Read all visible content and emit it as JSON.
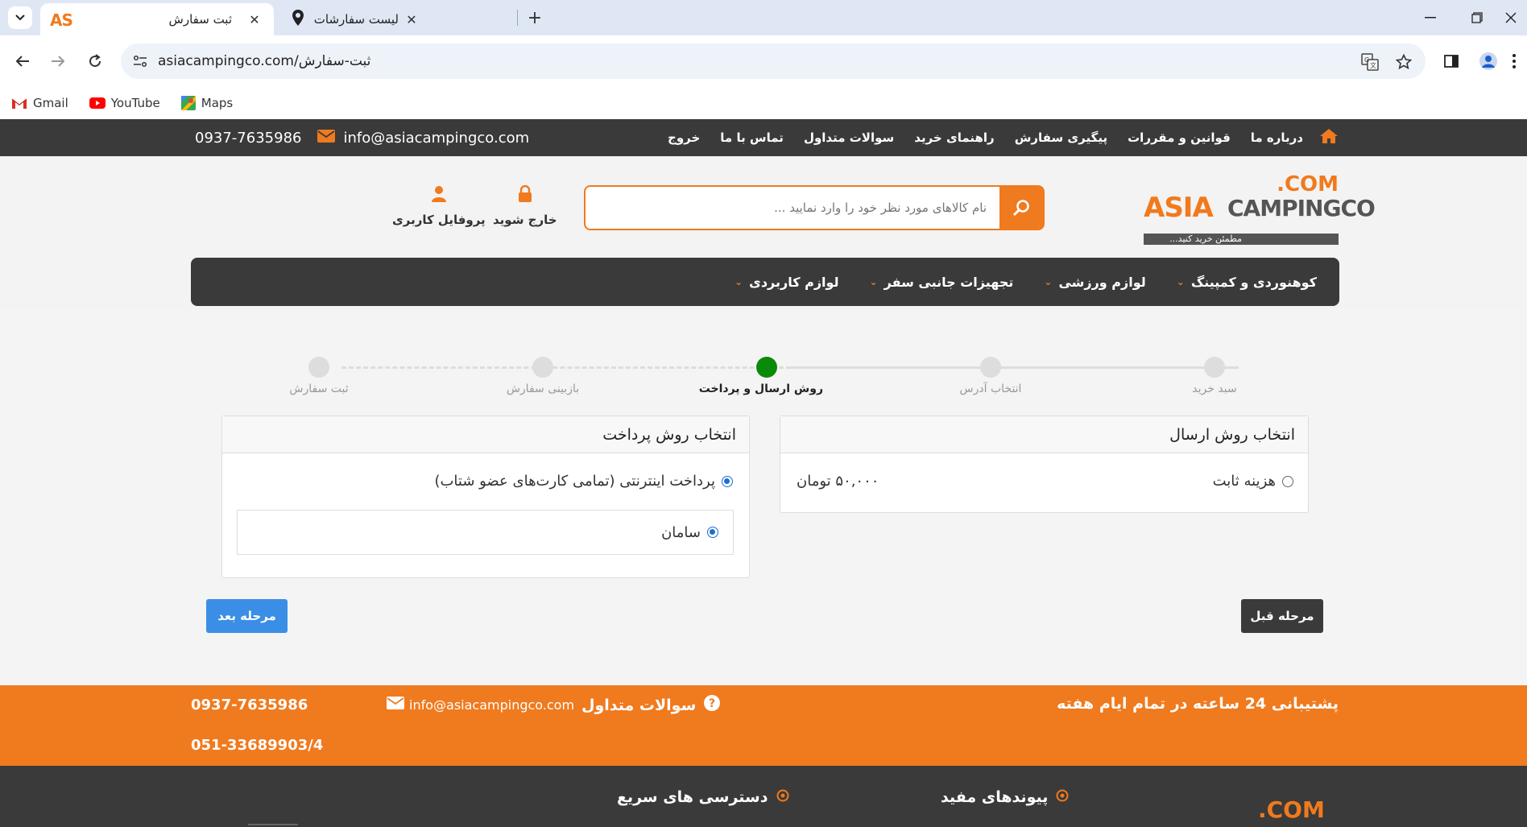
{
  "browser": {
    "tabs": [
      {
        "title": "ثبت سفارش",
        "favicon": "AS",
        "active": true
      },
      {
        "title": "لیست سفارشات",
        "active": false
      }
    ],
    "url": "asiacampingco.com/ثبت-سفارش",
    "bookmarks": [
      {
        "label": "Gmail"
      },
      {
        "label": "YouTube"
      },
      {
        "label": "Maps"
      }
    ]
  },
  "topbar": {
    "phone": "0937-7635986",
    "email": "info@asiacampingco.com",
    "menu": [
      "درباره ما",
      "قوانین و مقررات",
      "پیگیری سفارش",
      "راهنمای خرید",
      "سوالات متداول",
      "تماس با ما",
      "خروج"
    ]
  },
  "header": {
    "logo": {
      "dotcom": ".COM",
      "asia": "ASIA",
      "camping": "CAMPINGCO",
      "tagline": "مطمئن خرید کنید..."
    },
    "search_placeholder": "نام کالاهای مورد نظر خود را وارد نمایید ...",
    "logout_label": "خارج شوید",
    "profile_label": "پروفایل کاربری"
  },
  "categories": [
    "کوهنوردی و کمپینگ",
    "لوازم ورزشی",
    "تجهیزات جانبی سفر",
    "لوازم کاربردی"
  ],
  "steps": [
    {
      "label": "سبد خرید",
      "state": "done"
    },
    {
      "label": "انتخاب آدرس",
      "state": "done"
    },
    {
      "label": "روش ارسال و پرداخت",
      "state": "active"
    },
    {
      "label": "بازبینی سفارش",
      "state": "pending"
    },
    {
      "label": "ثبت سفارش",
      "state": "pending"
    }
  ],
  "shipping": {
    "title": "انتخاب روش ارسال",
    "option_label": "هزینه ثابت",
    "option_price": "۵۰,۰۰۰ تومان",
    "selected": false
  },
  "payment": {
    "title": "انتخاب روش پرداخت",
    "option_label": "پرداخت اینترنتی (تمامی کارت‌های عضو شتاب)",
    "gateway_label": "سامان",
    "selected": true
  },
  "buttons": {
    "next": "مرحله بعد",
    "prev": "مرحله قبل"
  },
  "footer": {
    "phone1": "0937-7635986",
    "phone2": "051-33689903/4",
    "email": "info@asiacampingco.com",
    "faq": "سوالات متداول",
    "support": "پشتیبانی 24 ساعته در تمام ایام هفته",
    "quick_access": "دسترسی های سریع",
    "useful_links": "پیوندهای مفید",
    "logo_dotcom": ".COM"
  },
  "colors": {
    "brand_orange": "#f07a1e",
    "dark": "#3a3a3a",
    "active_step": "#0a8a0a",
    "primary_button": "#3a8ee6"
  }
}
